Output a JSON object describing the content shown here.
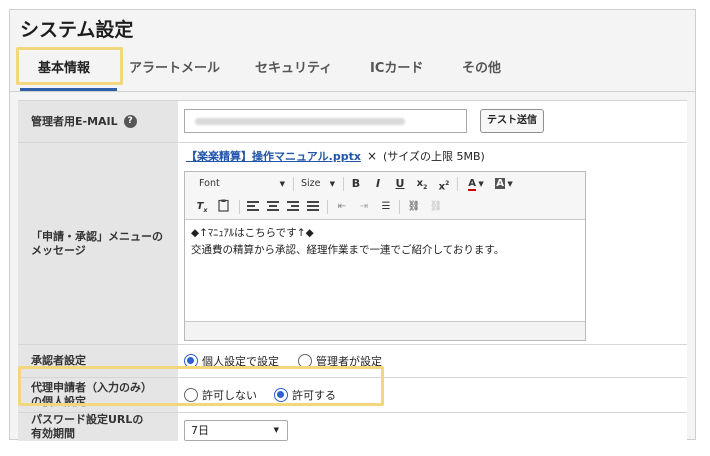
{
  "title": "システム設定",
  "tabs": [
    {
      "label": "基本情報",
      "active": true
    },
    {
      "label": "アラートメール",
      "active": false
    },
    {
      "label": "セキュリティ",
      "active": false
    },
    {
      "label": "ICカード",
      "active": false
    },
    {
      "label": "その他",
      "active": false
    }
  ],
  "rows": {
    "email": {
      "label": "管理者用E-MAIL",
      "help_icon": "?",
      "input_value": "",
      "test_button": "テスト送信"
    },
    "message": {
      "label": "「申請・承認」メニューの\nメッセージ",
      "file_link": "【楽楽精算】操作マニュアル.pptx",
      "remove": "×",
      "size_note": "(サイズの上限 5MB)",
      "editor": {
        "font_select": "Font",
        "size_select": "Size",
        "content": [
          "◆↑ﾏﾆｭｱﾙはこちらです↑◆",
          "交通費の精算から承認、経理作業まで一連でご紹介しております。"
        ]
      }
    },
    "approver": {
      "label": "承認者設定",
      "options": [
        "個人設定で設定",
        "管理者が設定"
      ],
      "selected": 0
    },
    "proxy": {
      "label": "代理申請者（入力のみ）\nの個人設定",
      "options": [
        "許可しない",
        "許可する"
      ],
      "selected": 1
    },
    "password_url": {
      "label": "パスワード設定URLの\n有効期間",
      "select_value": "7日"
    }
  },
  "colors": {
    "accent": "#2d5fa8",
    "highlight": "#f2d77d",
    "radio": "#2f5fd0",
    "link": "#2255aa"
  }
}
